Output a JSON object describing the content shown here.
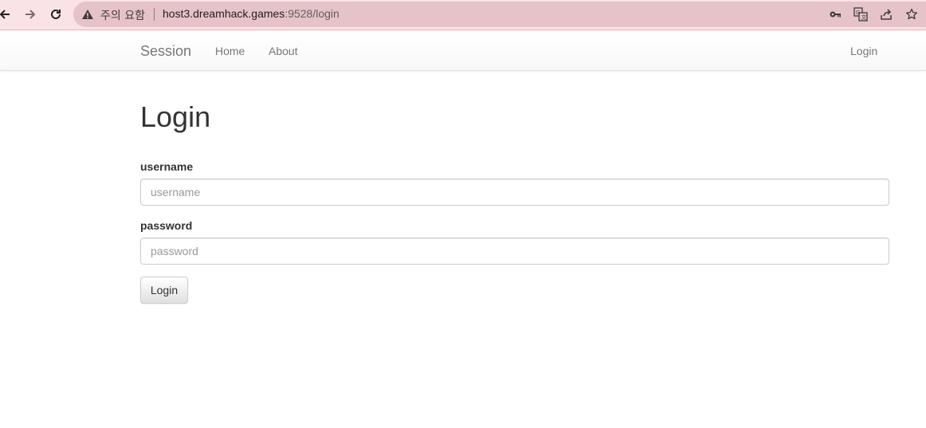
{
  "browser": {
    "security_label": "주의 요함",
    "url_host": "host3.dreamhack.games",
    "url_path": ":9528/login",
    "icons": [
      "back-icon",
      "forward-icon",
      "reload-icon",
      "warning-icon",
      "key-icon",
      "translate-icon",
      "share-icon",
      "bookmark-star-icon"
    ],
    "accent": "#e6c3c9"
  },
  "navbar": {
    "brand": "Session",
    "links": [
      {
        "label": "Home"
      },
      {
        "label": "About"
      }
    ],
    "right_link": "Login"
  },
  "main": {
    "title": "Login",
    "username": {
      "label": "username",
      "placeholder": "username",
      "value": ""
    },
    "password": {
      "label": "password",
      "placeholder": "password",
      "value": ""
    },
    "submit_label": "Login"
  }
}
